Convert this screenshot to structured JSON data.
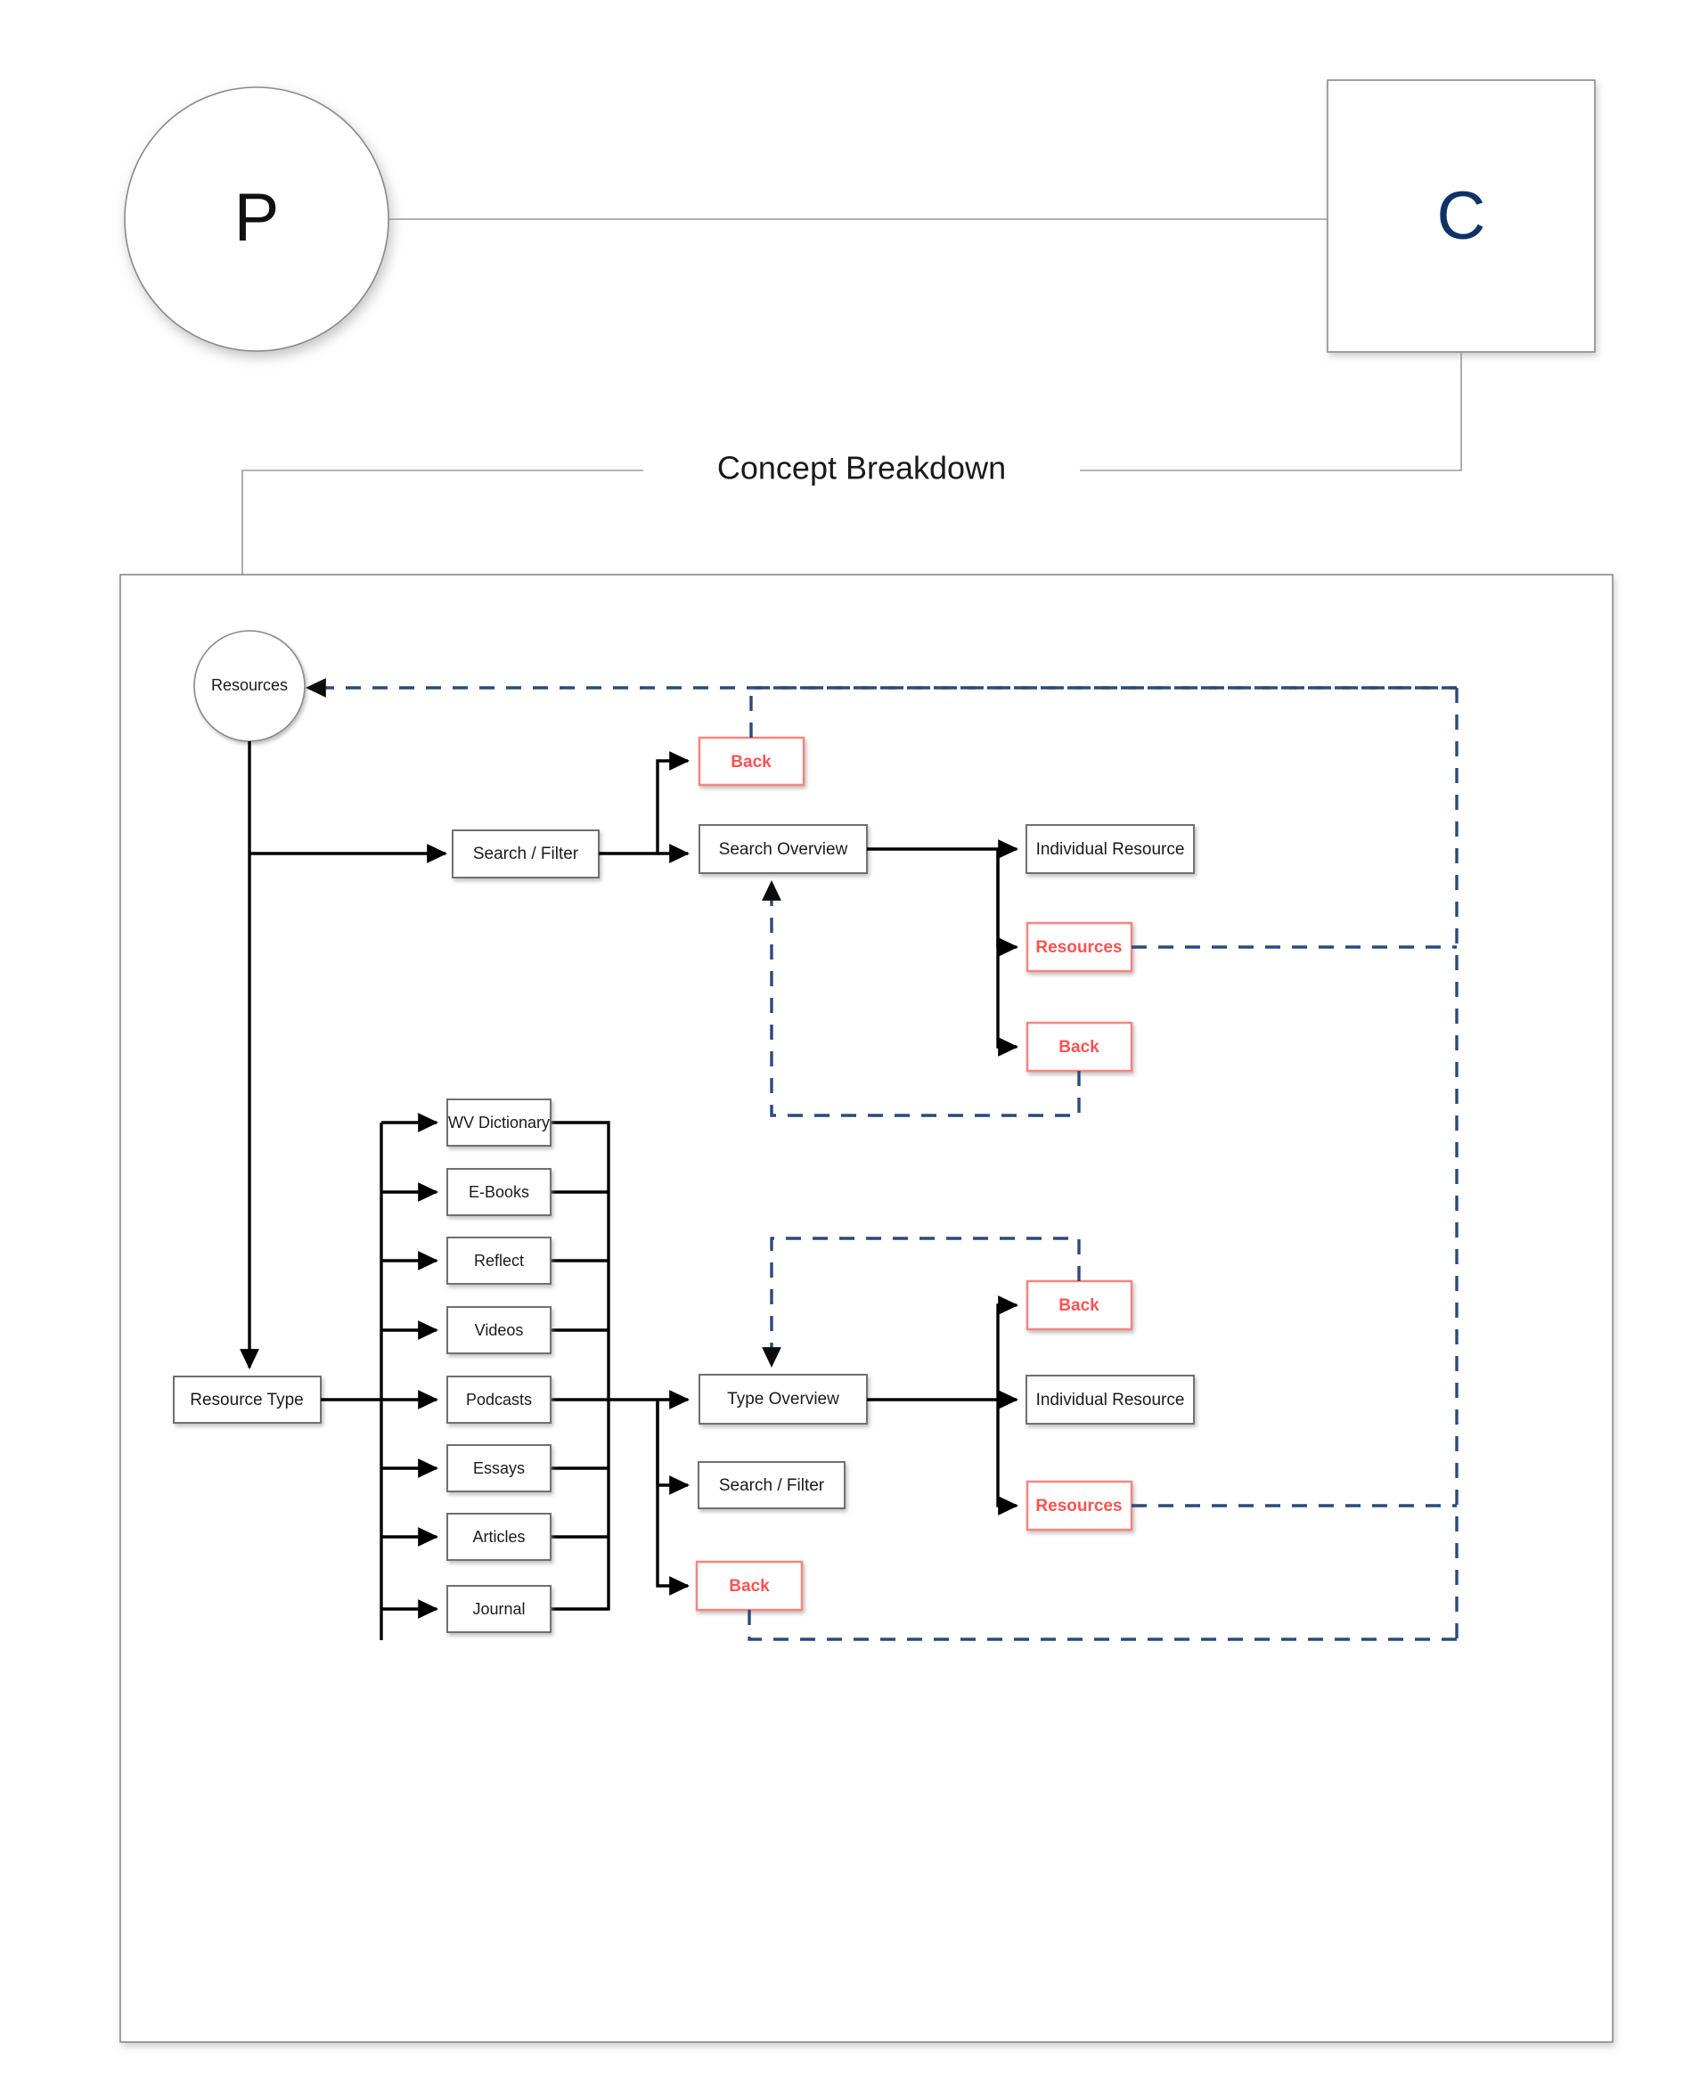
{
  "page": {
    "title": "Concept Breakdown",
    "bg_color": "#ffffff"
  },
  "colors": {
    "flow_solid": "#000000",
    "flow_dashed": "#2b4a7d",
    "red_border": "#f5867f",
    "red_text": "#ff5252",
    "node_border": "#707070",
    "navy_text": "#0e3265",
    "container_border": "#9a9a9a"
  },
  "top": {
    "persona_node": {
      "label": "P",
      "shape": "circle"
    },
    "concept_node": {
      "label": "C",
      "shape": "square"
    },
    "connector_label": "Concept Breakdown"
  },
  "breakdown": {
    "root": {
      "label": "Resources",
      "shape": "circle"
    },
    "branches": [
      {
        "name": "search-branch",
        "entry": {
          "label": "Search / Filter"
        },
        "overview": {
          "label": "Search Overview"
        },
        "back_top": {
          "label": "Back",
          "kind": "red"
        },
        "children": [
          {
            "label": "Individual Resource",
            "kind": "normal"
          },
          {
            "label": "Resources",
            "kind": "red"
          },
          {
            "label": "Back",
            "kind": "red"
          }
        ]
      },
      {
        "name": "type-branch",
        "entry": {
          "label": "Resource Type"
        },
        "overview": {
          "label": "Type Overview"
        },
        "types": [
          {
            "label": "WV Dictionary"
          },
          {
            "label": "E-Books"
          },
          {
            "label": "Reflect"
          },
          {
            "label": "Videos"
          },
          {
            "label": "Podcasts"
          },
          {
            "label": "Essays"
          },
          {
            "label": "Articles"
          },
          {
            "label": "Journal"
          }
        ],
        "siblings": [
          {
            "label": "Search / Filter",
            "kind": "normal"
          },
          {
            "label": "Back",
            "kind": "red"
          }
        ],
        "children": [
          {
            "label": "Back",
            "kind": "red"
          },
          {
            "label": "Individual Resource",
            "kind": "normal"
          },
          {
            "label": "Resources",
            "kind": "red"
          }
        ]
      }
    ]
  }
}
